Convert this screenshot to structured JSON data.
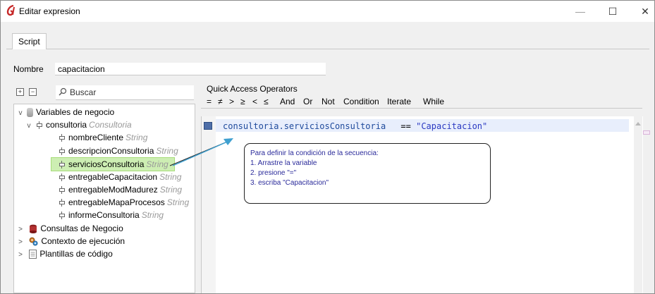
{
  "window": {
    "title": "Editar expresion",
    "controls": {
      "minimize": "—",
      "maximize": "☐",
      "close": "✕"
    }
  },
  "tabs": [
    {
      "label": "Script"
    }
  ],
  "form": {
    "nombre_label": "Nombre",
    "nombre_value": "capacitacion"
  },
  "tree_toolbar": {
    "expand_all": "+",
    "collapse_all": "−",
    "search_placeholder": "Buscar"
  },
  "tree": {
    "root": {
      "label": "Variables de negocio",
      "expander": "v"
    },
    "consultoria": {
      "label": "consultoria",
      "type": "Consultoria",
      "expander": "v"
    },
    "fields": [
      {
        "label": "nombreCliente",
        "type": "String"
      },
      {
        "label": "descripcionConsultoria",
        "type": "String"
      },
      {
        "label": "serviciosConsultoria",
        "type": "String"
      },
      {
        "label": "entregableCapacitacion",
        "type": "String"
      },
      {
        "label": "entregableModMadurez",
        "type": "String"
      },
      {
        "label": "entregableMapaProcesos",
        "type": "String"
      },
      {
        "label": "informeConsultoria",
        "type": "String"
      }
    ],
    "others": [
      {
        "label": "Consultas de Negocio",
        "expander": ">"
      },
      {
        "label": "Contexto de ejecución",
        "expander": ">"
      },
      {
        "label": "Plantillas de código",
        "expander": ">"
      }
    ]
  },
  "quick_access": {
    "label": "Quick Access Operators",
    "operators": [
      "=",
      "≠",
      ">",
      "≥",
      "<",
      "≤",
      "And",
      "Or",
      "Not",
      "Condition",
      "Iterate",
      "While"
    ]
  },
  "editor": {
    "code_variable": "consultoria.serviciosConsultoria",
    "code_operator": "==",
    "code_string": "\"Capacitacion\""
  },
  "callout": {
    "lines": [
      "Para definir la condición de la secuencia:",
      "1. Arrastre la variable",
      "2. presione \"=\"",
      "3. escriba \"Capacitacion\""
    ]
  },
  "colors": {
    "selection_bg": "#cdeeb3",
    "code_keyword": "#1e4a9c",
    "callout_text": "#2a2a9a",
    "app_icon": "#c62828"
  }
}
